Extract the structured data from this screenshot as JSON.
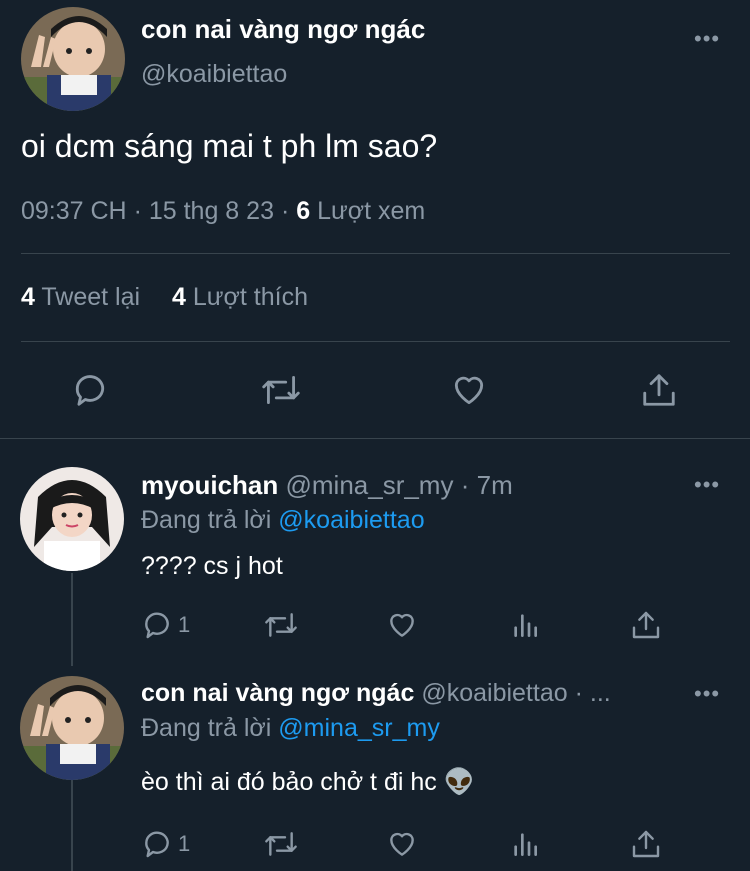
{
  "main_tweet": {
    "display_name": "con nai vàng ngơ ngác",
    "handle": "@koaibiettao",
    "text": "oi dcm sáng mai t ph lm sao?",
    "time": "09:37 CH",
    "sep1": "·",
    "date": "15 thg 8 23",
    "sep2": "·",
    "views_count": "6",
    "views_label": "Lượt xem",
    "retweets_count": "4",
    "retweets_label": "Tweet lại",
    "likes_count": "4",
    "likes_label": "Lượt thích",
    "more": "•••"
  },
  "replies": [
    {
      "display_name": "myouichan",
      "handle": "@mina_sr_my",
      "sep": "·",
      "time": "7m",
      "reply_prefix": "Đang trả lời",
      "reply_to": "@koaibiettao",
      "text": "???? cs j hot",
      "reply_count": "1",
      "more": "•••"
    },
    {
      "display_name": "con nai vàng ngơ ngác",
      "handle": "@koaibiettao",
      "sep": "·",
      "time": "...",
      "reply_prefix": "Đang trả lời",
      "reply_to": "@mina_sr_my",
      "text": "èo thì ai đó bảo chở t đi hc",
      "emoji": "👽",
      "reply_count": "1",
      "more": "•••"
    }
  ],
  "icons": {
    "reply": "reply-icon",
    "retweet": "retweet-icon",
    "like": "heart-icon",
    "share": "share-icon",
    "analytics": "analytics-icon"
  },
  "colors": {
    "background": "#15202b",
    "text": "#ffffff",
    "muted": "#8b98a5",
    "link": "#1d9bf0",
    "divider": "#38444d"
  }
}
